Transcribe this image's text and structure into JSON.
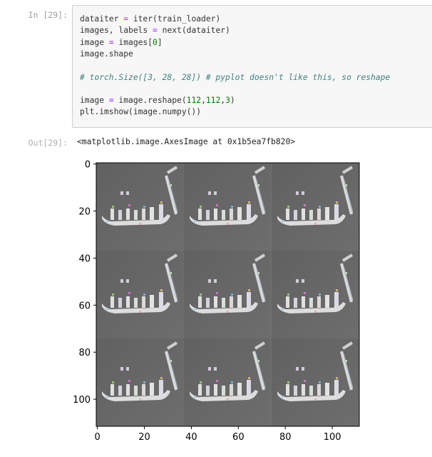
{
  "cell_in": {
    "prompt": "In [29]:",
    "lines": [
      [
        {
          "t": "dataiter "
        },
        {
          "t": "=",
          "c": "op"
        },
        {
          "t": " iter(train_loader)"
        }
      ],
      [
        {
          "t": "images, labels "
        },
        {
          "t": "=",
          "c": "op"
        },
        {
          "t": " next(dataiter)"
        }
      ],
      [
        {
          "t": "image "
        },
        {
          "t": "=",
          "c": "op"
        },
        {
          "t": " images["
        },
        {
          "t": "0",
          "c": "num"
        },
        {
          "t": "]"
        }
      ],
      [
        {
          "t": "image.shape"
        }
      ],
      [],
      [
        {
          "t": "# torch.Size([3, 28, 28]) # pyplot doesn't like this, so reshape",
          "c": "comment"
        }
      ],
      [],
      [
        {
          "t": "image "
        },
        {
          "t": "=",
          "c": "op"
        },
        {
          "t": " image.reshape("
        },
        {
          "t": "112",
          "c": "num"
        },
        {
          "t": ","
        },
        {
          "t": "112",
          "c": "num"
        },
        {
          "t": ","
        },
        {
          "t": "3",
          "c": "num"
        },
        {
          "t": ")"
        }
      ],
      [
        {
          "t": "plt.imshow(image.numpy())"
        }
      ]
    ]
  },
  "cell_out": {
    "prompt": "Out[29]:",
    "text": "<matplotlib.image.AxesImage at 0x1b5ea7fb820>"
  },
  "plot": {
    "x_ticks": [
      0,
      20,
      40,
      60,
      80,
      100
    ],
    "y_ticks": [
      0,
      20,
      40,
      60,
      80,
      100
    ],
    "extent": [
      -0.5,
      111.5
    ],
    "grid": "3x3 tiles of the same glyph image"
  }
}
